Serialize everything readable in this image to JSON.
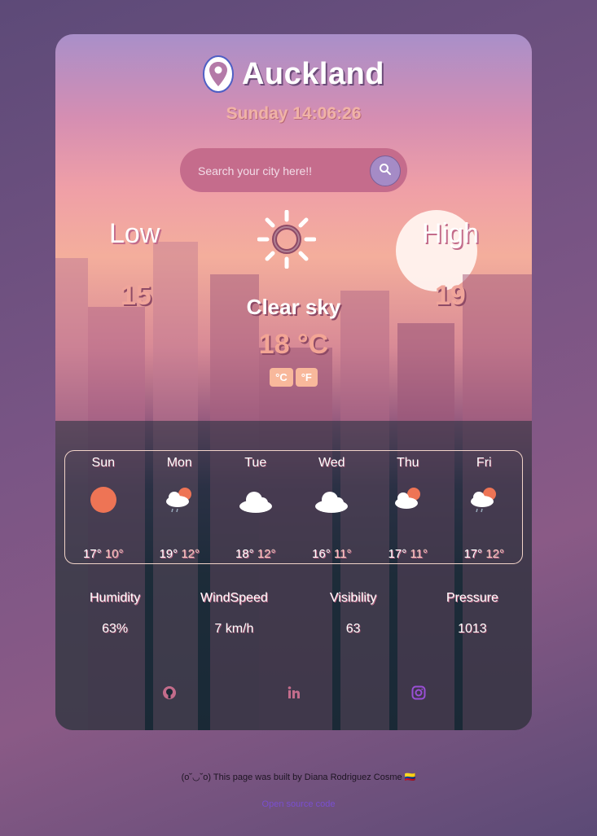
{
  "header": {
    "city": "Auckland",
    "datetime": "Sunday 14:06:26"
  },
  "search": {
    "placeholder": "Search your city here!!"
  },
  "current": {
    "low_label": "Low",
    "high_label": "High",
    "low": "15",
    "high": "19",
    "description": "Clear sky",
    "temperature": "18 °C",
    "unit_c": "°C",
    "unit_f": "°F",
    "icon": "sun-icon"
  },
  "forecast": [
    {
      "day": "Sun",
      "high": "17°",
      "low": "10°",
      "icon": "sun-icon"
    },
    {
      "day": "Mon",
      "high": "19°",
      "low": "12°",
      "icon": "sun-cloud-rain-icon"
    },
    {
      "day": "Tue",
      "high": "18°",
      "low": "12°",
      "icon": "cloud-icon"
    },
    {
      "day": "Wed",
      "high": "16°",
      "low": "11°",
      "icon": "cloud-icon"
    },
    {
      "day": "Thu",
      "high": "17°",
      "low": "11°",
      "icon": "sun-cloud-icon"
    },
    {
      "day": "Fri",
      "high": "17°",
      "low": "12°",
      "icon": "sun-cloud-rain-icon"
    }
  ],
  "stats": [
    {
      "label": "Humidity",
      "value": "63%"
    },
    {
      "label": "WindSpeed",
      "value": "7 km/h"
    },
    {
      "label": "Visibility",
      "value": "63"
    },
    {
      "label": "Pressure",
      "value": "1013"
    }
  ],
  "socials": [
    "github-icon",
    "linkedin-icon",
    "instagram-icon"
  ],
  "footer": {
    "text": "(o˘◡˘o) This page was built by Diana Rodriguez Cosme 🇨🇴",
    "link": "Open source code"
  },
  "colors": {
    "accent": "#f0a59a",
    "search_bg": "#c56c8c",
    "search_button": "#a58bc6"
  }
}
